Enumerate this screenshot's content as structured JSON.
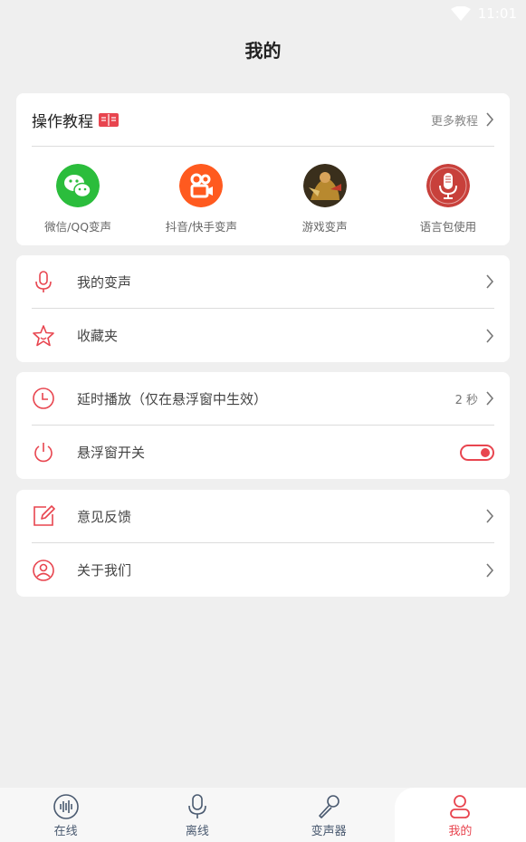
{
  "status": {
    "time": "11:01"
  },
  "title": "我的",
  "tutorial": {
    "title": "操作教程",
    "more": "更多教程",
    "items": [
      {
        "label": "微信/QQ变声",
        "icon": "wechat-icon",
        "color": "#2bbd3c"
      },
      {
        "label": "抖音/快手变声",
        "icon": "kuaishou-icon",
        "color": "#ff5a1f"
      },
      {
        "label": "游戏变声",
        "icon": "game-avatar-icon",
        "color": "#8a6b2a"
      },
      {
        "label": "语言包使用",
        "icon": "microphone-icon",
        "color": "#c8403b"
      }
    ]
  },
  "menu1": [
    {
      "label": "我的变声",
      "icon": "microphone-outline-icon"
    },
    {
      "label": "收藏夹",
      "icon": "star-icon"
    }
  ],
  "menu2": {
    "delay": {
      "label": "延时播放（仅在悬浮窗中生效）",
      "value": "2 秒",
      "icon": "clock-icon"
    },
    "float": {
      "label": "悬浮窗开关",
      "icon": "power-icon",
      "on": true
    }
  },
  "menu3": [
    {
      "label": "意见反馈",
      "icon": "edit-icon"
    },
    {
      "label": "关于我们",
      "icon": "user-circle-icon"
    }
  ],
  "tabs": [
    {
      "label": "在线",
      "icon": "waveform-icon"
    },
    {
      "label": "离线",
      "icon": "mic-tab-icon"
    },
    {
      "label": "变声器",
      "icon": "karaoke-mic-icon"
    },
    {
      "label": "我的",
      "icon": "person-icon",
      "active": true
    }
  ],
  "colors": {
    "accent": "#e8454f",
    "background": "#efefef"
  }
}
